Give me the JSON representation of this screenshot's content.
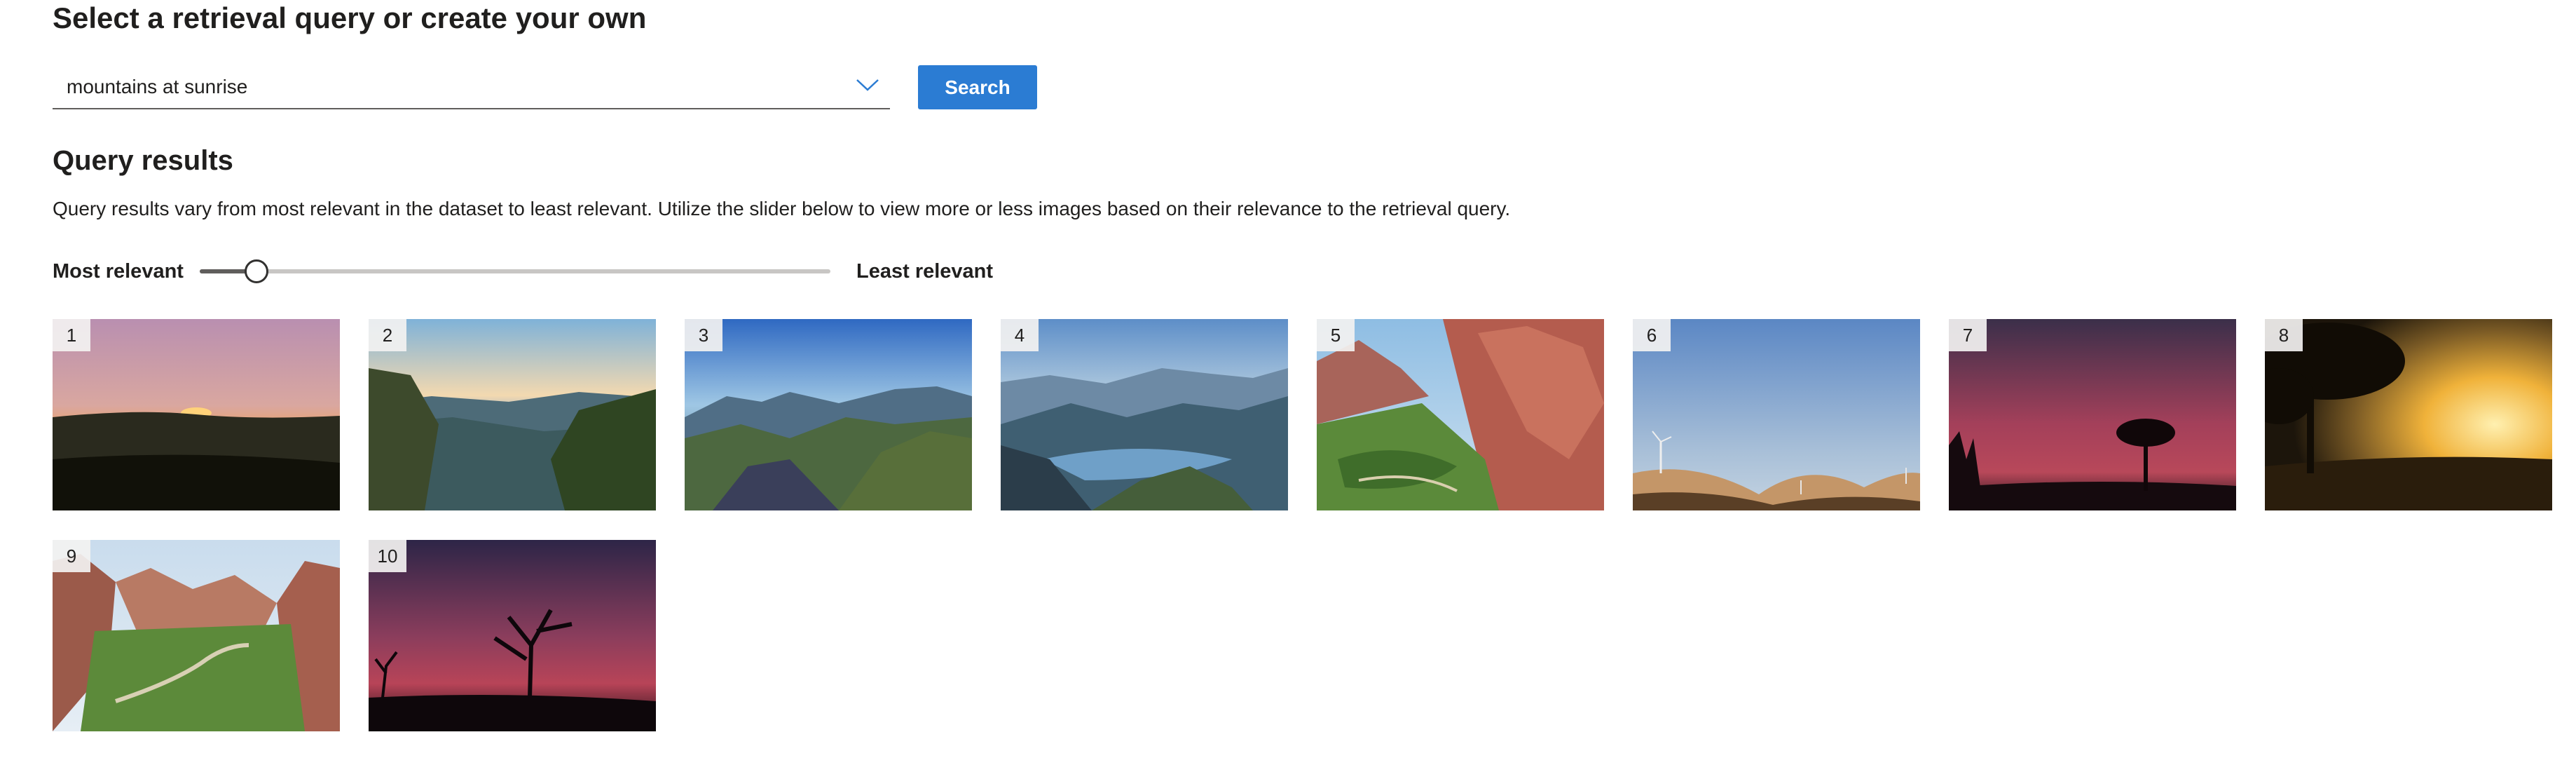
{
  "page_title": "Select a retrieval query or create your own",
  "query": {
    "value": "mountains at sunrise",
    "dropdown_icon": "chevron-down-icon"
  },
  "search_button": {
    "label": "Search",
    "color": "#2b7cd3"
  },
  "results": {
    "heading": "Query results",
    "description": "Query results vary from most relevant in the dataset to least relevant. Utilize the slider below to view more or less images based on their relevance to the retrieval query.",
    "slider": {
      "left_label": "Most relevant",
      "right_label": "Least relevant",
      "level": 0.09
    },
    "items": [
      {
        "rank": "1",
        "scene": "sunset-plain"
      },
      {
        "rank": "2",
        "scene": "canyon-overlook"
      },
      {
        "rank": "3",
        "scene": "blue-canyon"
      },
      {
        "rank": "4",
        "scene": "canyon-lake"
      },
      {
        "rank": "5",
        "scene": "red-cliffs"
      },
      {
        "rank": "6",
        "scene": "dunes-windmills"
      },
      {
        "rank": "7",
        "scene": "acacia-dusk"
      },
      {
        "rank": "8",
        "scene": "golden-savanna"
      },
      {
        "rank": "9",
        "scene": "valley-river"
      },
      {
        "rank": "10",
        "scene": "twilight-tree"
      }
    ]
  }
}
